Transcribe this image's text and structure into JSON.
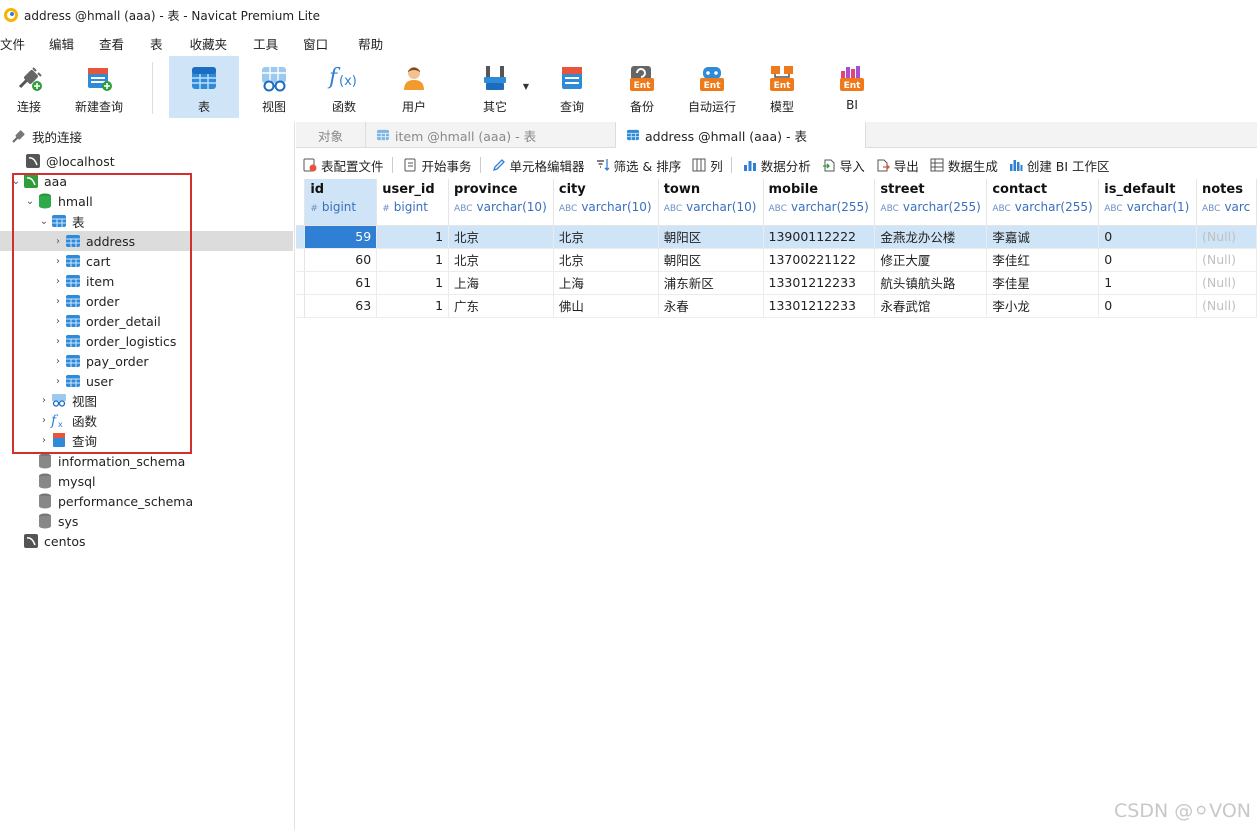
{
  "window": {
    "title": "address @hmall (aaa) - 表 - Navicat Premium Lite"
  },
  "menu": [
    "文件",
    "编辑",
    "查看",
    "表",
    "收藏夹",
    "工具",
    "窗口",
    "帮助"
  ],
  "toolbar": {
    "connect": "连接",
    "new_query": "新建查询",
    "table": "表",
    "view": "视图",
    "function": "函数",
    "user": "用户",
    "other": "其它",
    "query": "查询",
    "backup": "备份",
    "automation": "自动运行",
    "model": "模型",
    "bi": "BI",
    "ent_badge": "Ent"
  },
  "tree": {
    "root": "我的连接",
    "localhost": "@localhost",
    "aaa": "aaa",
    "hmall": "hmall",
    "tables_group": "表",
    "tables": [
      "address",
      "cart",
      "item",
      "order",
      "order_detail",
      "order_logistics",
      "pay_order",
      "user"
    ],
    "views_group": "视图",
    "functions_group": "函数",
    "queries_group": "查询",
    "other_dbs": [
      "information_schema",
      "mysql",
      "performance_schema",
      "sys"
    ],
    "centos": "centos"
  },
  "tabs": {
    "objects": "对象",
    "item_tab": "item @hmall (aaa) - 表",
    "address_tab": "address @hmall (aaa) - 表"
  },
  "objbar": {
    "table_config": "表配置文件",
    "begin_tx": "开始事务",
    "cell_editor": "单元格编辑器",
    "filter_sort": "筛选 & 排序",
    "columns": "列",
    "data_analysis": "数据分析",
    "import": "导入",
    "export": "导出",
    "data_gen": "数据生成",
    "create_bi": "创建 BI 工作区"
  },
  "grid": {
    "columns": [
      {
        "name": "id",
        "type": "bigint",
        "sym": "#"
      },
      {
        "name": "user_id",
        "type": "bigint",
        "sym": "#"
      },
      {
        "name": "province",
        "type": "varchar(10)",
        "sym": "ABC"
      },
      {
        "name": "city",
        "type": "varchar(10)",
        "sym": "ABC"
      },
      {
        "name": "town",
        "type": "varchar(10)",
        "sym": "ABC"
      },
      {
        "name": "mobile",
        "type": "varchar(255)",
        "sym": "ABC"
      },
      {
        "name": "street",
        "type": "varchar(255)",
        "sym": "ABC"
      },
      {
        "name": "contact",
        "type": "varchar(255)",
        "sym": "ABC"
      },
      {
        "name": "is_default",
        "type": "varchar(1)",
        "sym": "ABC"
      },
      {
        "name": "notes",
        "type": "varc",
        "sym": "ABC"
      }
    ],
    "rows": [
      [
        "59",
        "1",
        "北京",
        "北京",
        "朝阳区",
        "13900112222",
        "金燕龙办公楼",
        "李嘉诚",
        "0",
        "(Null)"
      ],
      [
        "60",
        "1",
        "北京",
        "北京",
        "朝阳区",
        "13700221122",
        "修正大厦",
        "李佳红",
        "0",
        "(Null)"
      ],
      [
        "61",
        "1",
        "上海",
        "上海",
        "浦东新区",
        "13301212233",
        "航头镇航头路",
        "李佳星",
        "1",
        "(Null)"
      ],
      [
        "63",
        "1",
        "广东",
        "佛山",
        "永春",
        "13301212233",
        "永春武馆",
        "李小龙",
        "0",
        "(Null)"
      ]
    ]
  },
  "watermark": "CSDN @⚪VON",
  "colors": {
    "accent": "#2f7fd4",
    "selection": "#cfe4f7",
    "highlight_box": "#d32f2f"
  }
}
